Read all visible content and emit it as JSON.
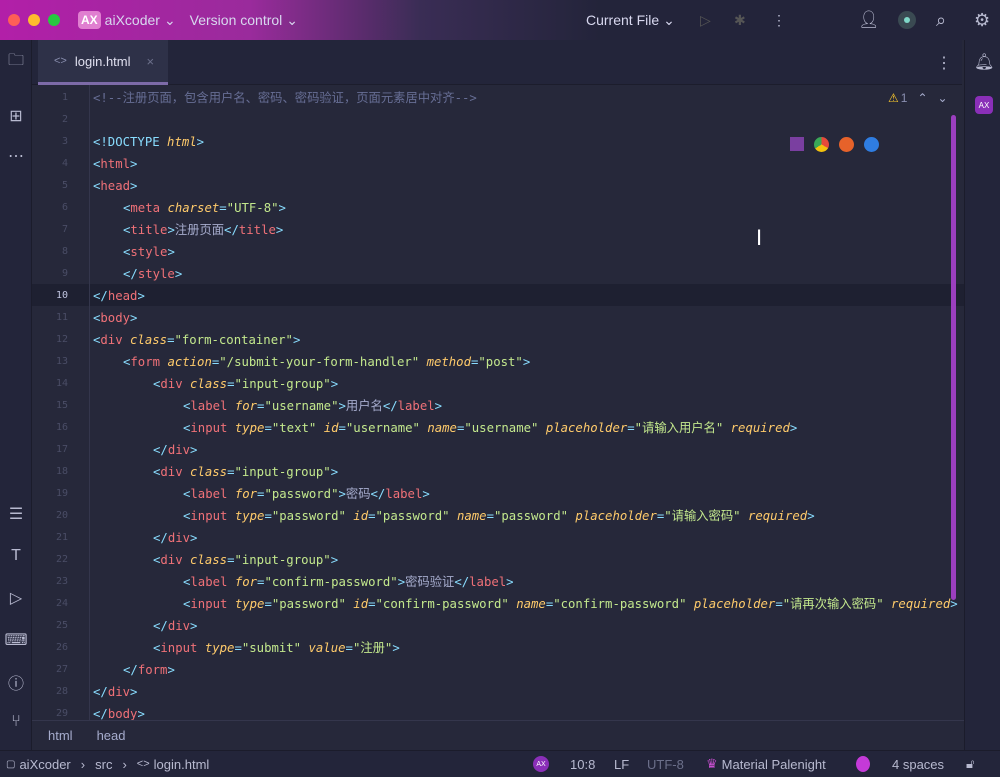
{
  "titlebar": {
    "project": "aiXcoder",
    "logo": "AX",
    "vcs": "Version control",
    "run_config": "Current File"
  },
  "tab": {
    "label": "login.html"
  },
  "editor": {
    "current_line": 10,
    "warnings": "1",
    "lines": [
      [
        [
          0,
          "cm",
          "<!--注册页面，包含用户名、密码、密码验证，页面元素居中对齐-->"
        ]
      ],
      [],
      [
        [
          0,
          "p",
          "<!DOCTYPE "
        ],
        [
          0,
          "at",
          "html"
        ],
        [
          0,
          "p",
          ">"
        ]
      ],
      [
        [
          0,
          "p",
          "<"
        ],
        [
          0,
          "tg",
          "html"
        ],
        [
          0,
          "p",
          ">"
        ]
      ],
      [
        [
          0,
          "p",
          "<"
        ],
        [
          0,
          "tg",
          "head"
        ],
        [
          0,
          "p",
          ">"
        ]
      ],
      [
        [
          1,
          "p",
          "<"
        ],
        [
          1,
          "tg",
          "meta "
        ],
        [
          1,
          "at",
          "charset"
        ],
        [
          1,
          "p",
          "="
        ],
        [
          1,
          "s",
          "\"UTF-8\""
        ],
        [
          1,
          "p",
          ">"
        ]
      ],
      [
        [
          1,
          "p",
          "<"
        ],
        [
          1,
          "tg",
          "title"
        ],
        [
          1,
          "p",
          ">"
        ],
        [
          1,
          "tx",
          "注册页面"
        ],
        [
          1,
          "p",
          "</"
        ],
        [
          1,
          "tg",
          "title"
        ],
        [
          1,
          "p",
          ">"
        ]
      ],
      [
        [
          1,
          "p",
          "<"
        ],
        [
          1,
          "tg",
          "style"
        ],
        [
          1,
          "p",
          ">"
        ]
      ],
      [
        [
          1,
          "p",
          "</"
        ],
        [
          1,
          "tg",
          "style"
        ],
        [
          1,
          "p",
          ">"
        ]
      ],
      [
        [
          0,
          "p",
          "</"
        ],
        [
          0,
          "tg",
          "head"
        ],
        [
          0,
          "p",
          ">"
        ]
      ],
      [
        [
          0,
          "p",
          "<"
        ],
        [
          0,
          "tg",
          "body"
        ],
        [
          0,
          "p",
          ">"
        ]
      ],
      [
        [
          0,
          "p",
          "<"
        ],
        [
          0,
          "tg",
          "div "
        ],
        [
          0,
          "at",
          "class"
        ],
        [
          0,
          "p",
          "="
        ],
        [
          0,
          "s",
          "\"form-container\""
        ],
        [
          0,
          "p",
          ">"
        ]
      ],
      [
        [
          1,
          "p",
          "<"
        ],
        [
          1,
          "tg",
          "form "
        ],
        [
          1,
          "at",
          "action"
        ],
        [
          1,
          "p",
          "="
        ],
        [
          1,
          "s",
          "\"/submit-your-form-handler\" "
        ],
        [
          1,
          "at",
          "method"
        ],
        [
          1,
          "p",
          "="
        ],
        [
          1,
          "s",
          "\"post\""
        ],
        [
          1,
          "p",
          ">"
        ]
      ],
      [
        [
          2,
          "p",
          "<"
        ],
        [
          2,
          "tg",
          "div "
        ],
        [
          2,
          "at",
          "class"
        ],
        [
          2,
          "p",
          "="
        ],
        [
          2,
          "s",
          "\"input-group\""
        ],
        [
          2,
          "p",
          ">"
        ]
      ],
      [
        [
          3,
          "p",
          "<"
        ],
        [
          3,
          "tg",
          "label "
        ],
        [
          3,
          "at",
          "for"
        ],
        [
          3,
          "p",
          "="
        ],
        [
          3,
          "s",
          "\"username\""
        ],
        [
          3,
          "p",
          ">"
        ],
        [
          3,
          "tx",
          "用户名"
        ],
        [
          3,
          "p",
          "</"
        ],
        [
          3,
          "tg",
          "label"
        ],
        [
          3,
          "p",
          ">"
        ]
      ],
      [
        [
          3,
          "p",
          "<"
        ],
        [
          3,
          "tg",
          "input "
        ],
        [
          3,
          "at",
          "type"
        ],
        [
          3,
          "p",
          "="
        ],
        [
          3,
          "s",
          "\"text\" "
        ],
        [
          3,
          "at",
          "id"
        ],
        [
          3,
          "p",
          "="
        ],
        [
          3,
          "s",
          "\"username\" "
        ],
        [
          3,
          "at",
          "name"
        ],
        [
          3,
          "p",
          "="
        ],
        [
          3,
          "s",
          "\"username\" "
        ],
        [
          3,
          "at",
          "placeholder"
        ],
        [
          3,
          "p",
          "="
        ],
        [
          3,
          "s",
          "\"请输入用户名\" "
        ],
        [
          3,
          "at",
          "required"
        ],
        [
          3,
          "p",
          ">"
        ]
      ],
      [
        [
          2,
          "p",
          "</"
        ],
        [
          2,
          "tg",
          "div"
        ],
        [
          2,
          "p",
          ">"
        ]
      ],
      [
        [
          2,
          "p",
          "<"
        ],
        [
          2,
          "tg",
          "div "
        ],
        [
          2,
          "at",
          "class"
        ],
        [
          2,
          "p",
          "="
        ],
        [
          2,
          "s",
          "\"input-group\""
        ],
        [
          2,
          "p",
          ">"
        ]
      ],
      [
        [
          3,
          "p",
          "<"
        ],
        [
          3,
          "tg",
          "label "
        ],
        [
          3,
          "at",
          "for"
        ],
        [
          3,
          "p",
          "="
        ],
        [
          3,
          "s",
          "\"password\""
        ],
        [
          3,
          "p",
          ">"
        ],
        [
          3,
          "tx",
          "密码"
        ],
        [
          3,
          "p",
          "</"
        ],
        [
          3,
          "tg",
          "label"
        ],
        [
          3,
          "p",
          ">"
        ]
      ],
      [
        [
          3,
          "p",
          "<"
        ],
        [
          3,
          "tg",
          "input "
        ],
        [
          3,
          "at",
          "type"
        ],
        [
          3,
          "p",
          "="
        ],
        [
          3,
          "s",
          "\"password\" "
        ],
        [
          3,
          "at",
          "id"
        ],
        [
          3,
          "p",
          "="
        ],
        [
          3,
          "s",
          "\"password\" "
        ],
        [
          3,
          "at",
          "name"
        ],
        [
          3,
          "p",
          "="
        ],
        [
          3,
          "s",
          "\"password\" "
        ],
        [
          3,
          "at",
          "placeholder"
        ],
        [
          3,
          "p",
          "="
        ],
        [
          3,
          "s",
          "\"请输入密码\" "
        ],
        [
          3,
          "at",
          "required"
        ],
        [
          3,
          "p",
          ">"
        ]
      ],
      [
        [
          2,
          "p",
          "</"
        ],
        [
          2,
          "tg",
          "div"
        ],
        [
          2,
          "p",
          ">"
        ]
      ],
      [
        [
          2,
          "p",
          "<"
        ],
        [
          2,
          "tg",
          "div "
        ],
        [
          2,
          "at",
          "class"
        ],
        [
          2,
          "p",
          "="
        ],
        [
          2,
          "s",
          "\"input-group\""
        ],
        [
          2,
          "p",
          ">"
        ]
      ],
      [
        [
          3,
          "p",
          "<"
        ],
        [
          3,
          "tg",
          "label "
        ],
        [
          3,
          "at",
          "for"
        ],
        [
          3,
          "p",
          "="
        ],
        [
          3,
          "s",
          "\"confirm-password\""
        ],
        [
          3,
          "p",
          ">"
        ],
        [
          3,
          "tx",
          "密码验证"
        ],
        [
          3,
          "p",
          "</"
        ],
        [
          3,
          "tg",
          "label"
        ],
        [
          3,
          "p",
          ">"
        ]
      ],
      [
        [
          3,
          "p",
          "<"
        ],
        [
          3,
          "tg",
          "input "
        ],
        [
          3,
          "at",
          "type"
        ],
        [
          3,
          "p",
          "="
        ],
        [
          3,
          "s",
          "\"password\" "
        ],
        [
          3,
          "at",
          "id"
        ],
        [
          3,
          "p",
          "="
        ],
        [
          3,
          "s",
          "\"confirm-password\" "
        ],
        [
          3,
          "at",
          "name"
        ],
        [
          3,
          "p",
          "="
        ],
        [
          3,
          "s",
          "\"confirm-password\" "
        ],
        [
          3,
          "at",
          "placeholder"
        ],
        [
          3,
          "p",
          "="
        ],
        [
          3,
          "s",
          "\"请再次输入密码\" "
        ],
        [
          3,
          "at",
          "required"
        ],
        [
          3,
          "p",
          ">"
        ]
      ],
      [
        [
          2,
          "p",
          "</"
        ],
        [
          2,
          "tg",
          "div"
        ],
        [
          2,
          "p",
          ">"
        ]
      ],
      [
        [
          2,
          "p",
          "<"
        ],
        [
          2,
          "tg",
          "input "
        ],
        [
          2,
          "at",
          "type"
        ],
        [
          2,
          "p",
          "="
        ],
        [
          2,
          "s",
          "\"submit\" "
        ],
        [
          2,
          "at",
          "value"
        ],
        [
          2,
          "p",
          "="
        ],
        [
          2,
          "s",
          "\"注册\""
        ],
        [
          2,
          "p",
          ">"
        ]
      ],
      [
        [
          1,
          "p",
          "</"
        ],
        [
          1,
          "tg",
          "form"
        ],
        [
          1,
          "p",
          ">"
        ]
      ],
      [
        [
          0,
          "p",
          "</"
        ],
        [
          0,
          "tg",
          "div"
        ],
        [
          0,
          "p",
          ">"
        ]
      ],
      [
        [
          0,
          "p",
          "</"
        ],
        [
          0,
          "tg",
          "body"
        ],
        [
          0,
          "p",
          ">"
        ]
      ]
    ]
  },
  "crumbs": [
    "html",
    "head"
  ],
  "status": {
    "path": [
      "aiXcoder",
      "src",
      "login.html"
    ],
    "position": "10:8",
    "line_ending": "LF",
    "encoding": "UTF-8",
    "theme": "Material Palenight",
    "indent": "4 spaces"
  }
}
